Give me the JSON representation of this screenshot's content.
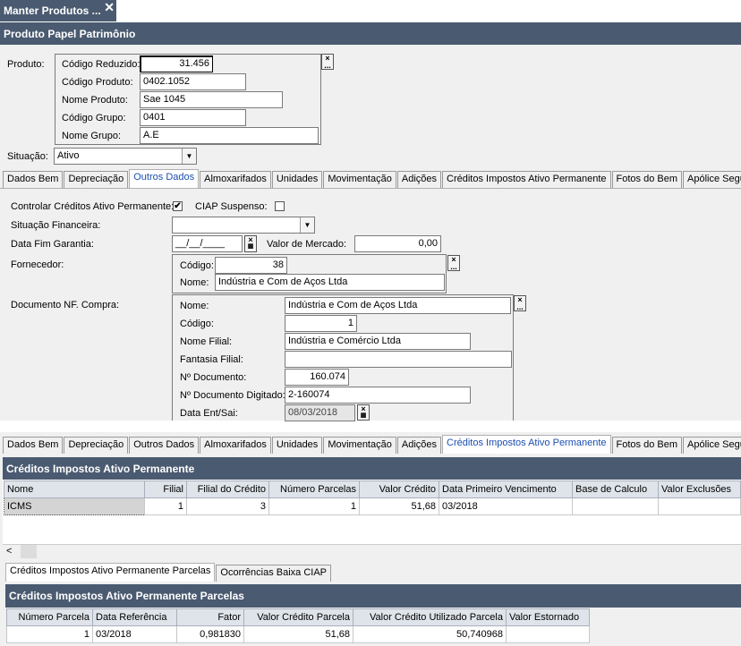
{
  "window": {
    "doc_tab": "Manter Produtos ...",
    "close_glyph": "✕"
  },
  "header": {
    "title": "Produto Papel Patrimônio"
  },
  "produto": {
    "label": "Produto:",
    "codigo_reduzido_label": "Código Reduzido:",
    "codigo_reduzido": "31.456",
    "codigo_produto_label": "Código Produto:",
    "codigo_produto": "0402.1052",
    "nome_produto_label": "Nome Produto:",
    "nome_produto": "Sae 1045",
    "codigo_grupo_label": "Código Grupo:",
    "codigo_grupo": "0401",
    "nome_grupo_label": "Nome Grupo:",
    "nome_grupo": "A.E"
  },
  "situacao": {
    "label": "Situação:",
    "value": "Ativo"
  },
  "tabs": [
    "Dados Bem",
    "Depreciação",
    "Outros Dados",
    "Almoxarifados",
    "Unidades",
    "Movimentação",
    "Adições",
    "Créditos Impostos Ativo Permanente",
    "Fotos do Bem",
    "Apólice Seguro"
  ],
  "outros": {
    "controlar_label": "Controlar Créditos Ativo Permanente:",
    "controlar_checked": "✔",
    "ciap_label": "CIAP Suspenso:",
    "sit_fin_label": "Situação Financeira:",
    "data_fim_label": "Data Fim Garantia:",
    "data_fim": "__/__/____",
    "valor_mercado_label": "Valor de Mercado:",
    "valor_mercado": "0,00",
    "fornecedor_label": "Fornecedor:",
    "forn_codigo_label": "Código:",
    "forn_codigo": "38",
    "forn_nome_label": "Nome:",
    "forn_nome": "Indústria e Com de Aços Ltda",
    "doc_label": "Documento NF. Compra:",
    "doc_nome_label": "Nome:",
    "doc_nome": "Indústria e Com de Aços Ltda",
    "doc_codigo_label": "Código:",
    "doc_codigo": "1",
    "doc_filial_label": "Nome Filial:",
    "doc_filial": "Indústria e Comércio Ltda",
    "doc_fantasia_label": "Fantasia Filial:",
    "doc_fantasia": "",
    "doc_num_label": "Nº Documento:",
    "doc_num": "160.074",
    "doc_num_dig_label": "Nº Documento Digitado:",
    "doc_num_dig": "2-160074",
    "doc_data_label": "Data Ent/Sai:",
    "doc_data": "08/03/2018"
  },
  "creditos": {
    "title": "Créditos Impostos Ativo Permanente",
    "columns": [
      "Nome",
      "Filial",
      "Filial do Crédito",
      "Número Parcelas",
      "Valor Crédito",
      "Data Primeiro Vencimento",
      "Base de Calculo",
      "Valor Exclusões"
    ],
    "rows": [
      [
        "ICMS",
        "1",
        "3",
        "1",
        "51,68",
        "03/2018",
        "",
        ""
      ]
    ]
  },
  "sub_tabs": [
    "Créditos Impostos Ativo Permanente Parcelas",
    "Ocorrências Baixa CIAP"
  ],
  "parcelas": {
    "title": "Créditos Impostos Ativo Permanente Parcelas",
    "columns": [
      "Número Parcela",
      "Data Referência",
      "Fator",
      "Valor Crédito Parcela",
      "Valor Crédito Utilizado Parcela",
      "Valor Estornado"
    ],
    "rows": [
      [
        "1",
        "03/2018",
        "0,981830",
        "51,68",
        "50,740968",
        ""
      ]
    ]
  },
  "icons": {
    "clear": "×",
    "ellipsis": "...",
    "calendar": "calendar-icon",
    "dropdown": "▼",
    "scroll_left": "<"
  }
}
